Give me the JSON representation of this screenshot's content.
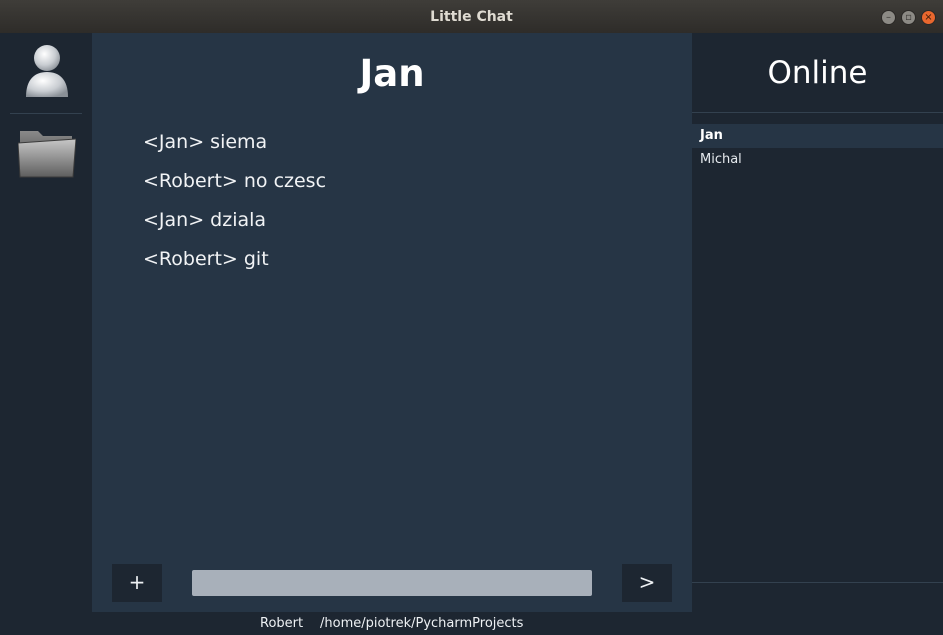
{
  "window": {
    "title": "Little Chat",
    "controls": [
      "minimize-icon",
      "maximize-icon",
      "close-icon"
    ],
    "close_color": "#e9672e"
  },
  "sidebar": {
    "icons": [
      "user-icon",
      "folder-icon"
    ]
  },
  "chat": {
    "title": "Jan",
    "messages": [
      "<Jan> siema",
      "<Robert> no czesc",
      "<Jan> dziala",
      "<Robert> git"
    ],
    "add_label": "+",
    "send_label": ">",
    "input_value": ""
  },
  "online": {
    "title": "Online",
    "users": [
      {
        "name": "Jan",
        "selected": true
      },
      {
        "name": "Michal",
        "selected": false
      }
    ]
  },
  "status": {
    "user": "Robert",
    "path": "/home/piotrek/PycharmProjects"
  },
  "colors": {
    "panel_dark": "#1d2631",
    "panel_chat": "#263545",
    "input_bg": "#a8b0ba"
  }
}
